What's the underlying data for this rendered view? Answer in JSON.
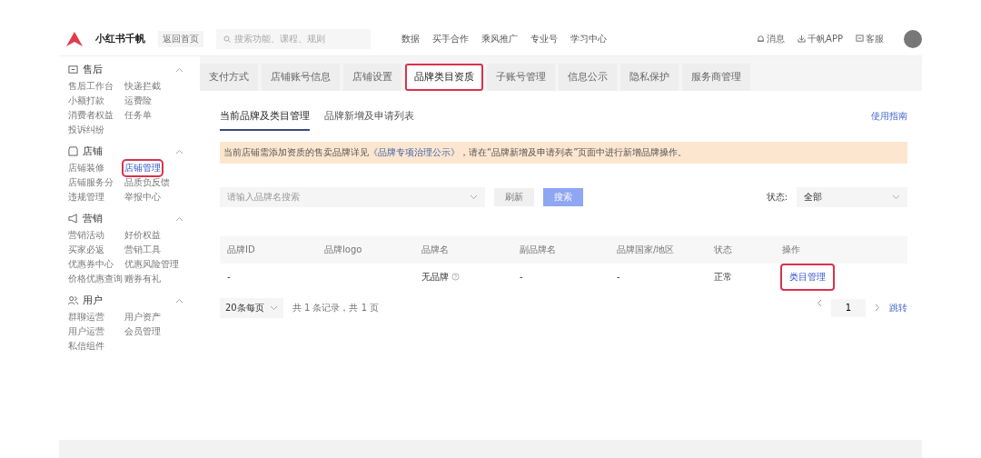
{
  "topbar": {
    "logo": "小红书千帆",
    "back": "返回首页",
    "search": {
      "placeholder": "搜索功能、课程、规则"
    },
    "nav": [
      "数据",
      "买手合作",
      "乘风推广",
      "专业号",
      "学习中心"
    ],
    "actions": [
      {
        "kind": "bell",
        "label": "消息"
      },
      {
        "kind": "download",
        "label": "千帆APP"
      },
      {
        "kind": "chat",
        "label": "客服"
      }
    ]
  },
  "sidebar": {
    "groups": [
      {
        "kind": "aftersale",
        "title": "售后",
        "expanded": true,
        "items": [
          {
            "label": "售后工作台",
            "selected": false,
            "highlighted": false
          },
          {
            "label": "快递拦截",
            "selected": false,
            "highlighted": false
          },
          {
            "label": "小额打款",
            "selected": false,
            "highlighted": false
          },
          {
            "label": "运费险",
            "selected": false,
            "highlighted": false
          },
          {
            "label": "消费者权益",
            "selected": false,
            "highlighted": false
          },
          {
            "label": "任务单",
            "selected": false,
            "highlighted": false
          },
          {
            "label": "投诉纠纷",
            "selected": false,
            "highlighted": false
          }
        ]
      },
      {
        "kind": "shop",
        "title": "店铺",
        "expanded": true,
        "items": [
          {
            "label": "店铺装修",
            "selected": false,
            "highlighted": false
          },
          {
            "label": "店铺管理",
            "selected": true,
            "highlighted": true
          },
          {
            "label": "店铺服务分",
            "selected": false,
            "highlighted": false
          },
          {
            "label": "品质负反馈",
            "selected": false,
            "highlighted": false
          },
          {
            "label": "违规管理",
            "selected": false,
            "highlighted": false
          },
          {
            "label": "举报中心",
            "selected": false,
            "highlighted": false
          }
        ]
      },
      {
        "kind": "marketing",
        "title": "营销",
        "expanded": true,
        "items": [
          {
            "label": "营销活动",
            "selected": false,
            "highlighted": false
          },
          {
            "label": "好价权益",
            "selected": false,
            "highlighted": false
          },
          {
            "label": "买家必返",
            "selected": false,
            "highlighted": false
          },
          {
            "label": "营销工具",
            "selected": false,
            "highlighted": false
          },
          {
            "label": "优惠券中心",
            "selected": false,
            "highlighted": false
          },
          {
            "label": "优惠风险管理",
            "selected": false,
            "highlighted": false
          },
          {
            "label": "价格优惠查询",
            "selected": false,
            "highlighted": false
          },
          {
            "label": "赠券有礼",
            "selected": false,
            "highlighted": false
          }
        ]
      },
      {
        "kind": "user",
        "title": "用户",
        "expanded": true,
        "items": [
          {
            "label": "群聊运营",
            "selected": false,
            "highlighted": false
          },
          {
            "label": "用户资产",
            "selected": false,
            "highlighted": false
          },
          {
            "label": "用户运营",
            "selected": false,
            "highlighted": false
          },
          {
            "label": "会员管理",
            "selected": false,
            "highlighted": false
          },
          {
            "label": "私信组件",
            "selected": false,
            "highlighted": false
          }
        ]
      }
    ]
  },
  "tabs": [
    {
      "label": "支付方式",
      "selected": false,
      "highlighted": false
    },
    {
      "label": "店铺账号信息",
      "selected": false,
      "highlighted": false
    },
    {
      "label": "店铺设置",
      "selected": false,
      "highlighted": false
    },
    {
      "label": "品牌类目资质",
      "selected": true,
      "highlighted": true
    },
    {
      "label": "子账号管理",
      "selected": false,
      "highlighted": false
    },
    {
      "label": "信息公示",
      "selected": false,
      "highlighted": false
    },
    {
      "label": "隐私保护",
      "selected": false,
      "highlighted": false
    },
    {
      "label": "服务商管理",
      "selected": false,
      "highlighted": false
    }
  ],
  "subtabs": [
    {
      "label": "当前品牌及类目管理",
      "selected": true
    },
    {
      "label": "品牌新增及申请列表",
      "selected": false
    }
  ],
  "guide_link": "使用指南",
  "notice": {
    "before": "当前店铺需添加资质的售卖品牌详见",
    "link": "《品牌专项治理公示》",
    "after": "，请在“品牌新增及申请列表”页面中进行新增品牌操作。"
  },
  "filter": {
    "placeholder": "请输入品牌名搜索",
    "refresh": "刷新",
    "search": "搜索",
    "status_label": "状态:",
    "status_value": "全部"
  },
  "table": {
    "columns": [
      "品牌ID",
      "品牌logo",
      "品牌名",
      "副品牌名",
      "品牌国家/地区",
      "状态",
      "操作"
    ],
    "rows": [
      {
        "cells": [
          "-",
          "",
          "无品牌",
          "-",
          "-",
          "正常"
        ],
        "action": "类目管理",
        "action_highlighted": true
      }
    ]
  },
  "pagination": {
    "page_size": "20条每页",
    "summary": "共 1 条记录，共 1 页",
    "page": "1",
    "jump": "跳转"
  }
}
